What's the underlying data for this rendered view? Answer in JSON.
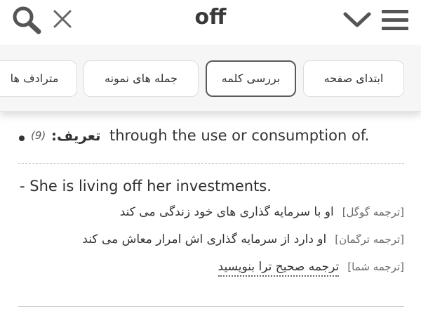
{
  "header": {
    "title": "off",
    "icons": [
      "search-icon",
      "close-icon",
      "chevron-down-icon",
      "menu-icon"
    ]
  },
  "tabs": [
    {
      "label": "ابتدای صفحه"
    },
    {
      "label": "بررسی کلمه",
      "active": true
    },
    {
      "label": "جمله های نمونه"
    },
    {
      "label": "مترادف ها"
    }
  ],
  "definition": {
    "label": "تعریف:",
    "count": "(9)",
    "text": "through the use or consumption of."
  },
  "example": {
    "sentence": "- She is living off her investments.",
    "translations": [
      {
        "label": "[ترجمه گوگل]",
        "text": "او با سرمایه گذاری های خود زندگی می کند"
      },
      {
        "label": "[ترجمه ترگمان]",
        "text": "او دارد از سرمایه گذاری اش امرار معاش می کند"
      },
      {
        "label": "[ترجمه شما]",
        "text": "ترجمه صحیح ترا بنویسید"
      }
    ]
  },
  "colors": {
    "text": "#333333",
    "tabbar_bg": "#f6f6f6",
    "active_border": "#5a5a5a"
  }
}
